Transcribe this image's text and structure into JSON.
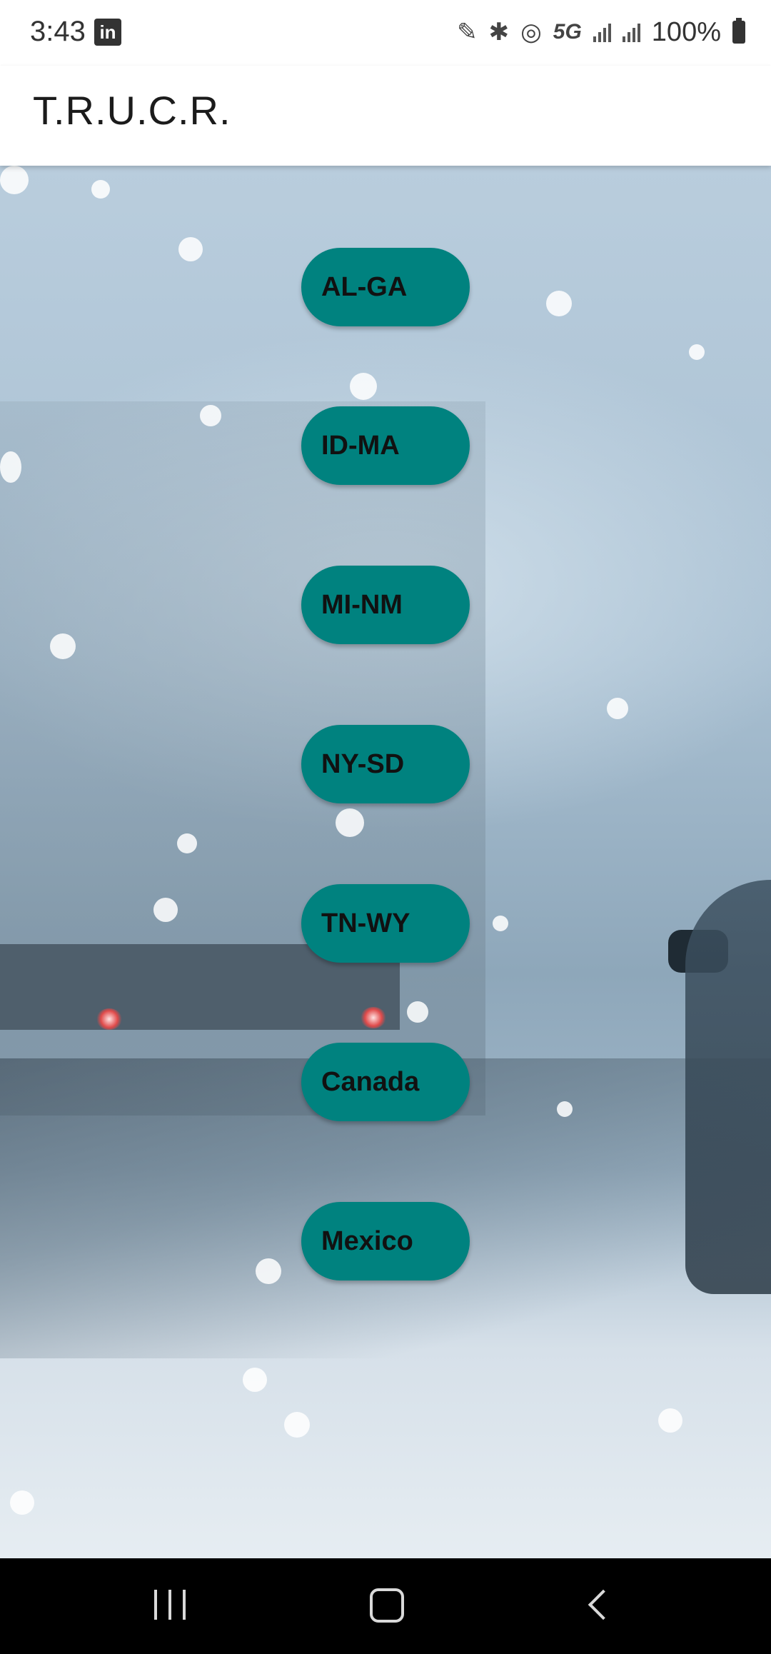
{
  "status_bar": {
    "time": "3:43",
    "notification_icon": "linkedin-icon",
    "linkedin_glyph": "in",
    "network": "5G",
    "battery": "100%"
  },
  "app_bar": {
    "title": "T.R.U.C.R."
  },
  "buttons": [
    {
      "label": "AL-GA"
    },
    {
      "label": "ID-MA"
    },
    {
      "label": "MI-NM"
    },
    {
      "label": "NY-SD"
    },
    {
      "label": "TN-WY"
    },
    {
      "label": "Canada"
    },
    {
      "label": "Mexico"
    }
  ],
  "colors": {
    "button_fill": "#00827f",
    "button_text": "#111111"
  },
  "nav_bar": {
    "recents_icon": "recents-icon",
    "home_icon": "home-icon",
    "back_icon": "back-icon"
  }
}
